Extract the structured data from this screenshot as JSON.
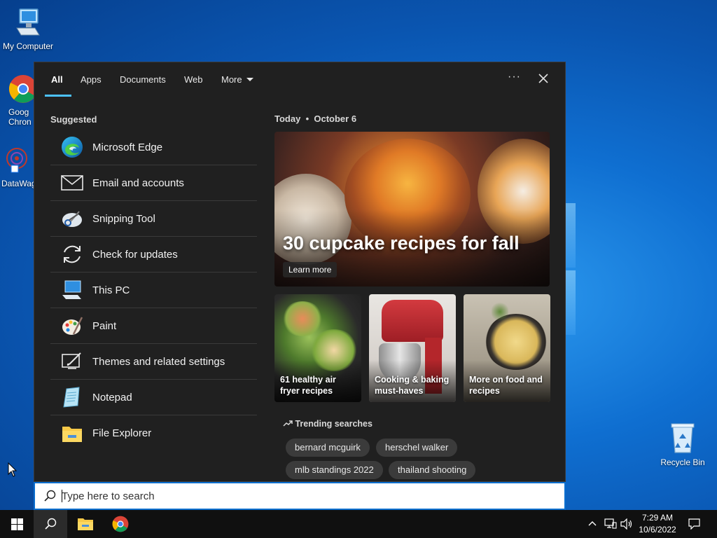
{
  "desktop": {
    "icons": [
      {
        "label": "My Computer"
      },
      {
        "label": "Goog Chron"
      },
      {
        "label": "DataWag"
      },
      {
        "label": "Recycle Bin"
      }
    ]
  },
  "search_panel": {
    "tabs": [
      {
        "label": "All",
        "active": true
      },
      {
        "label": "Apps"
      },
      {
        "label": "Documents"
      },
      {
        "label": "Web"
      },
      {
        "label": "More"
      }
    ],
    "more_options_label": "···",
    "suggested_title": "Suggested",
    "suggested": [
      {
        "label": "Microsoft Edge",
        "icon": "edge-icon"
      },
      {
        "label": "Email and accounts",
        "icon": "mail-icon"
      },
      {
        "label": "Snipping Tool",
        "icon": "snipping-tool-icon"
      },
      {
        "label": "Check for updates",
        "icon": "refresh-icon"
      },
      {
        "label": "This PC",
        "icon": "computer-icon"
      },
      {
        "label": "Paint",
        "icon": "paint-palette-icon"
      },
      {
        "label": "Themes and related settings",
        "icon": "themes-brush-icon"
      },
      {
        "label": "Notepad",
        "icon": "notepad-icon"
      },
      {
        "label": "File Explorer",
        "icon": "folder-icon"
      }
    ],
    "today_label": "Today",
    "today_date": "October 6",
    "hero": {
      "title": "30 cupcake recipes for fall",
      "button": "Learn more"
    },
    "tiles": [
      {
        "caption": "61 healthy air fryer recipes"
      },
      {
        "caption": "Cooking & baking must-haves"
      },
      {
        "caption": "More on food and recipes"
      }
    ],
    "trending_title": "Trending searches",
    "trending": [
      "bernard mcguirk",
      "herschel walker",
      "mlb standings 2022",
      "thailand shooting"
    ]
  },
  "searchbox": {
    "placeholder": "Type here to search"
  },
  "taskbar": {
    "time": "7:29 AM",
    "date": "10/6/2022"
  }
}
